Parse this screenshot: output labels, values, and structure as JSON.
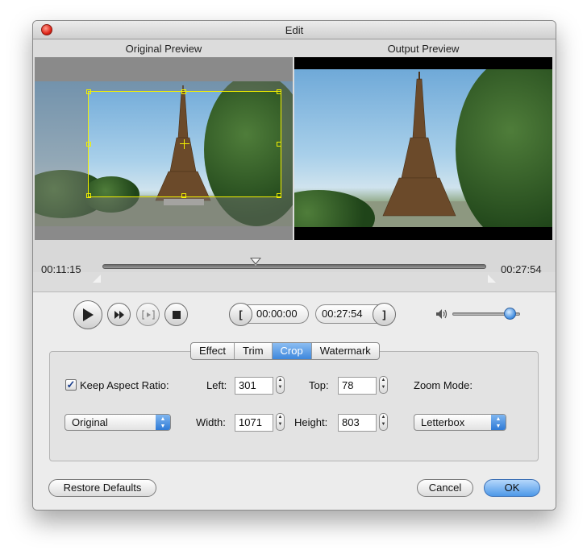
{
  "window": {
    "title": "Edit"
  },
  "preview": {
    "original_title": "Original Preview",
    "output_title": "Output Preview"
  },
  "timeline": {
    "start_time": "00:11:15",
    "end_time": "00:27:54",
    "playhead_fraction": 0.4
  },
  "playback": {
    "play_icon": "play-icon",
    "next_frame_icon": "fast-forward-icon",
    "preview_icon": "bracket-play-icon",
    "stop_icon": "stop-icon",
    "start_bracket": "[",
    "start_time": "00:00:00",
    "end_time": "00:27:54",
    "end_bracket": "]",
    "volume_icon": "speaker-icon",
    "volume_level": 0.85
  },
  "tabs": [
    {
      "label": "Effect",
      "active": false
    },
    {
      "label": "Trim",
      "active": false
    },
    {
      "label": "Crop",
      "active": true
    },
    {
      "label": "Watermark",
      "active": false
    }
  ],
  "crop": {
    "keep_aspect_label": "Keep Aspect Ratio:",
    "keep_aspect_checked": true,
    "left_label": "Left:",
    "left_value": "301",
    "top_label": "Top:",
    "top_value": "78",
    "zoom_mode_label": "Zoom Mode:",
    "aspect_select_value": "Original",
    "width_label": "Width:",
    "width_value": "1071",
    "height_label": "Height:",
    "height_value": "803",
    "zoom_mode_value": "Letterbox"
  },
  "footer": {
    "restore_label": "Restore Defaults",
    "cancel_label": "Cancel",
    "ok_label": "OK"
  },
  "colors": {
    "accent": "#4d98e8",
    "crop_frame": "#f3f000",
    "close_button": "#e0261a"
  }
}
